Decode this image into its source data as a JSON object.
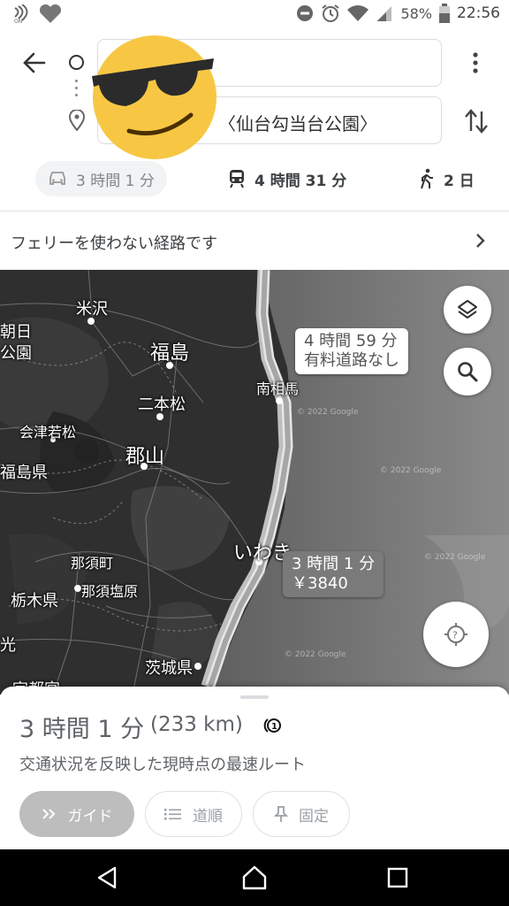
{
  "status_bar": {
    "battery": "58%",
    "time": "22:56",
    "nfc_label": "ON"
  },
  "search": {
    "origin_value": "",
    "destination_value": "〈仙台勾当台公園〉"
  },
  "modes": {
    "car": "3 時間 1 分",
    "transit": "4 時間 31 分",
    "walk": "2 日"
  },
  "notice": {
    "text": "フェリーを使わない経路です"
  },
  "map": {
    "places": {
      "yonezawa": "米沢",
      "asahi_frag": "朝日",
      "park_frag": "公園",
      "fukushima": "福島",
      "nihonmatsu": "二本松",
      "minamisoma": "南相馬",
      "aizuwakamatsu": "会津若松",
      "koriyama": "郡山",
      "fukushima_pref": "福島県",
      "iwaki": "いわき",
      "nasu": "那須町",
      "nasushiobara": "那須塩原",
      "tochigi": "栃木県",
      "hikari_frag": "光",
      "ibaraki": "茨城県",
      "utsunomiya_frag": "宇都宮"
    },
    "alt_route": {
      "line1": "4 時間 59 分",
      "line2": "有料道路なし"
    },
    "main_route": {
      "line1": "3 時間 1 分",
      "line2": "￥3840"
    },
    "copyright": "© 2022 Google"
  },
  "sheet": {
    "duration": "3 時間 1 分",
    "distance": "(233 km)",
    "description": "交通状況を反映した現時点の最速ルート",
    "guide_label": "ガイド",
    "steps_label": "道順",
    "pin_label": "固定"
  },
  "colors": {
    "route": "#c9c9c9",
    "sticker": "#f7c744"
  }
}
